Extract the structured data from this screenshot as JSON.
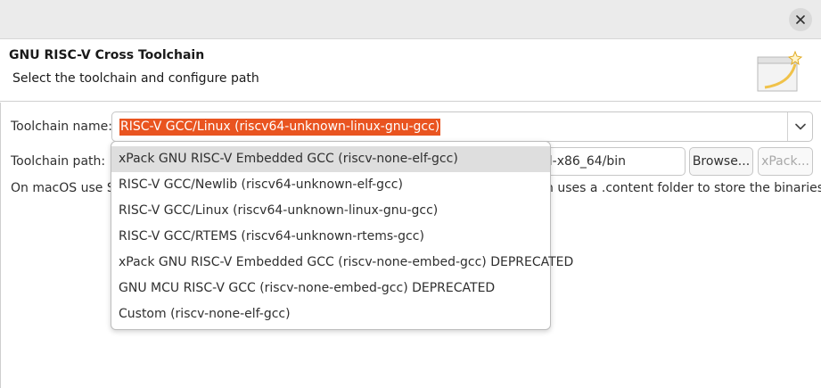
{
  "header": {
    "title": "GNU RISC-V Cross Toolchain",
    "subtitle": "Select the toolchain and configure path"
  },
  "form": {
    "toolchain_name_label": "Toolchain name:",
    "toolchain_name_value": "RISC-V GCC/Linux (riscv64-unknown-linux-gnu-gcc)",
    "toolchain_path_label": "Toolchain path:",
    "toolchain_path_value_visible": "sl-x86_64/bin",
    "browse_label": "Browse...",
    "xpack_label": "xPack...",
    "note_left": "On macOS use Sh",
    "note_right": "n uses a .content folder to store the binaries."
  },
  "dropdown": {
    "items": [
      "xPack GNU RISC-V Embedded GCC (riscv-none-elf-gcc)",
      "RISC-V GCC/Newlib (riscv64-unknown-elf-gcc)",
      "RISC-V GCC/Linux (riscv64-unknown-linux-gnu-gcc)",
      "RISC-V GCC/RTEMS (riscv64-unknown-rtems-gcc)",
      "xPack GNU RISC-V Embedded GCC (riscv-none-embed-gcc) DEPRECATED",
      "GNU MCU RISC-V GCC (riscv-none-embed-gcc) DEPRECATED",
      "Custom (riscv-none-elf-gcc)"
    ],
    "hovered_index": 0
  },
  "icons": {
    "close": "close-icon",
    "wizard": "wizard-banner-icon",
    "combo_arrow": "chevron-down-icon"
  },
  "colors": {
    "selection": "#e95420",
    "titlebar": "#ebebeb",
    "hover": "#dedede"
  }
}
